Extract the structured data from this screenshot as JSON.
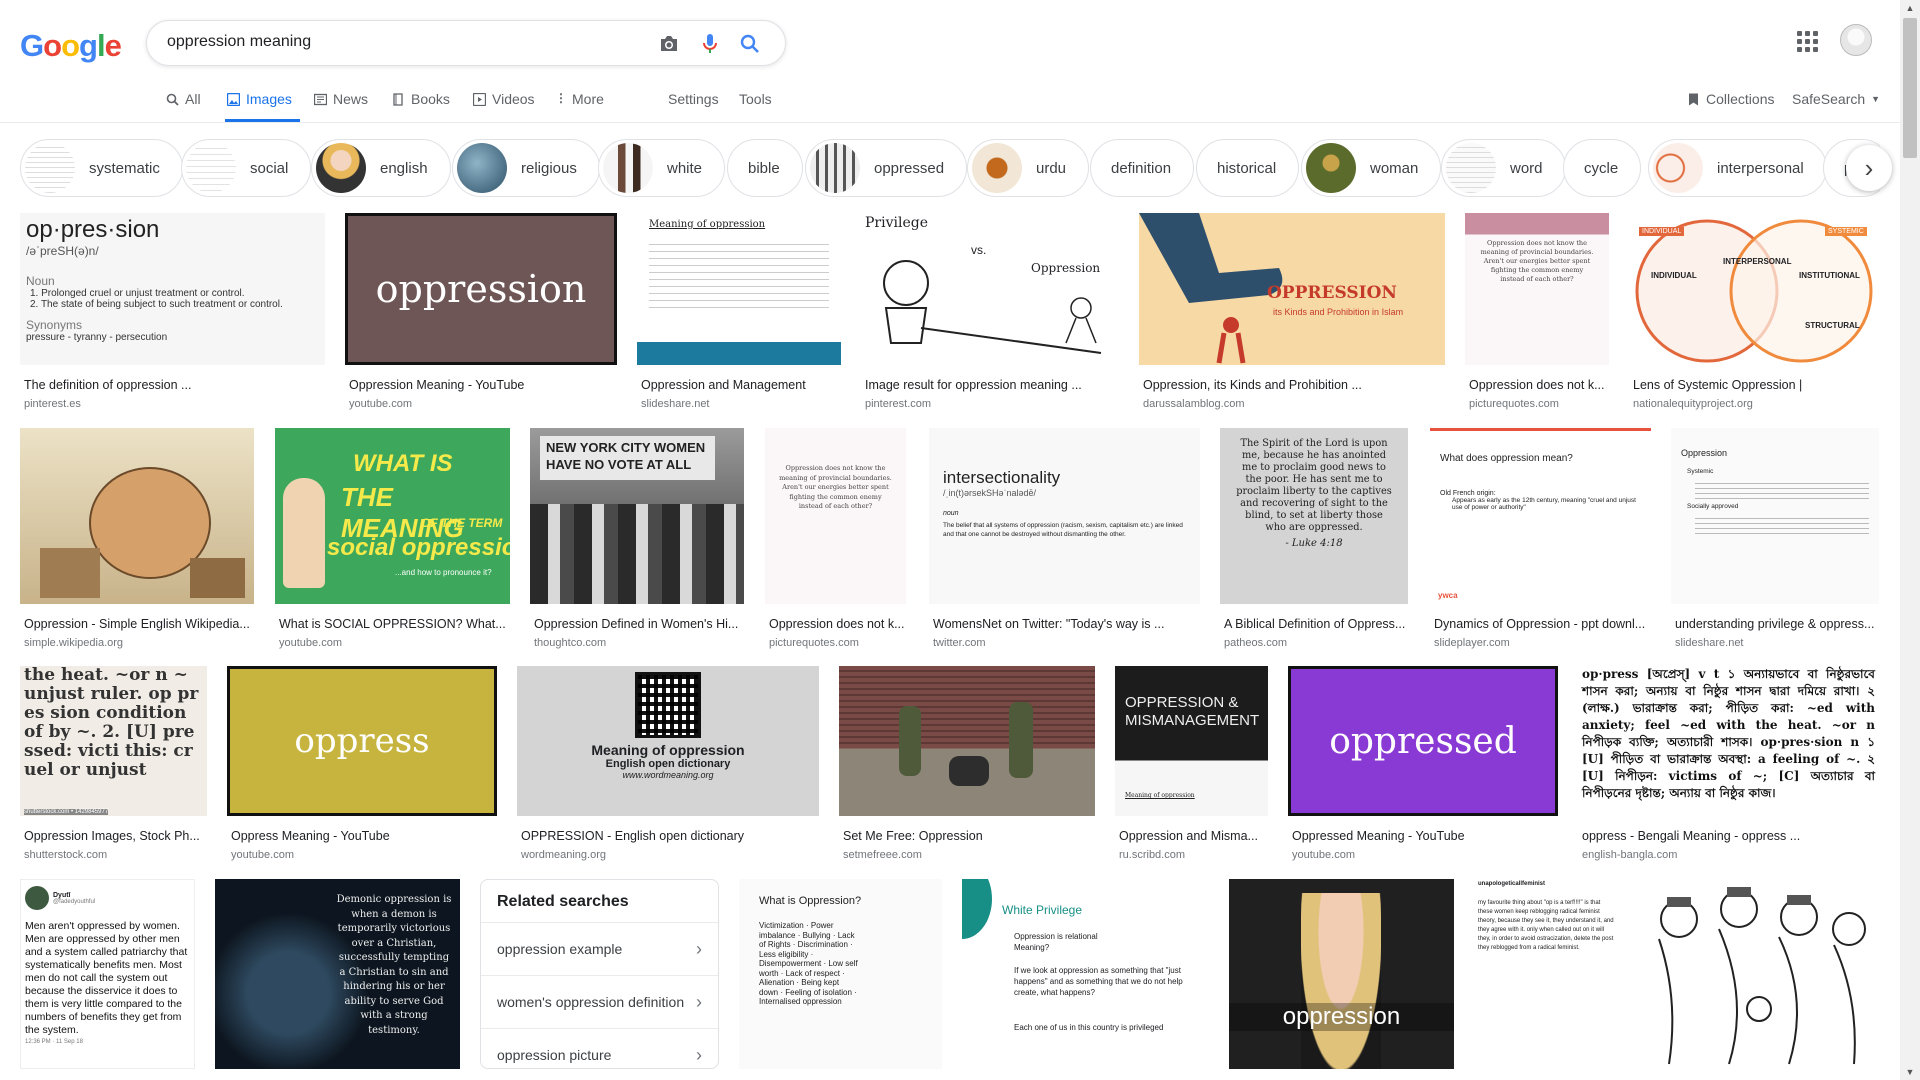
{
  "logo": {
    "letters": [
      "G",
      "o",
      "o",
      "g",
      "l",
      "e"
    ],
    "colors": [
      "#4285f4",
      "#ea4335",
      "#fbbc05",
      "#4285f4",
      "#34a853",
      "#ea4335"
    ]
  },
  "search": {
    "value": "oppression meaning"
  },
  "tabs": [
    {
      "label": "All",
      "icon": "search-icon"
    },
    {
      "label": "Images",
      "icon": "image-icon",
      "active": true
    },
    {
      "label": "News",
      "icon": "news-icon"
    },
    {
      "label": "Books",
      "icon": "book-icon"
    },
    {
      "label": "Videos",
      "icon": "video-icon"
    },
    {
      "label": "More",
      "icon": "more-vert-icon"
    },
    {
      "label": "Settings"
    },
    {
      "label": "Tools"
    }
  ],
  "right_tools": {
    "collections": "Collections",
    "safesearch": "SafeSearch"
  },
  "chips": [
    {
      "label": "systematic"
    },
    {
      "label": "social"
    },
    {
      "label": "english"
    },
    {
      "label": "religious"
    },
    {
      "label": "white"
    },
    {
      "label": "bible"
    },
    {
      "label": "oppressed"
    },
    {
      "label": "urdu"
    },
    {
      "label": "definition"
    },
    {
      "label": "historical"
    },
    {
      "label": "woman"
    },
    {
      "label": "word"
    },
    {
      "label": "cycle"
    },
    {
      "label": "interpersonal"
    },
    {
      "label": "pov"
    }
  ],
  "results": [
    {
      "title": "The definition of oppression ...",
      "site": "pinterest.es"
    },
    {
      "title": "Oppression Meaning - YouTube",
      "site": "youtube.com"
    },
    {
      "title": "Oppression and Management",
      "site": "slideshare.net"
    },
    {
      "title": "Image result for oppression meaning ...",
      "site": "pinterest.com"
    },
    {
      "title": "Oppression, its Kinds and Prohibition ...",
      "site": "darussalamblog.com"
    },
    {
      "title": "Oppression does not k...",
      "site": "picturequotes.com"
    },
    {
      "title": "Lens of Systemic Oppression |",
      "site": "nationalequityproject.org"
    },
    {
      "title": "Oppression - Simple English Wikipedia...",
      "site": "simple.wikipedia.org"
    },
    {
      "title": "What is SOCIAL OPPRESSION? What...",
      "site": "youtube.com"
    },
    {
      "title": "Oppression Defined in Women's Hi...",
      "site": "thoughtco.com"
    },
    {
      "title": "Oppression does not k...",
      "site": "picturequotes.com"
    },
    {
      "title": "WomensNet on Twitter: \"Today's way is ...",
      "site": "twitter.com"
    },
    {
      "title": "A Biblical Definition of Oppress...",
      "site": "patheos.com"
    },
    {
      "title": "Dynamics of Oppression - ppt downl...",
      "site": "slideplayer.com"
    },
    {
      "title": "understanding privilege & oppress...",
      "site": "slideshare.net"
    },
    {
      "title": "Oppression Images, Stock Ph...",
      "site": "shutterstock.com"
    },
    {
      "title": "Oppress Meaning - YouTube",
      "site": "youtube.com"
    },
    {
      "title": "OPPRESSION - English open dictionary",
      "site": "wordmeaning.org"
    },
    {
      "title": "Set Me Free: Oppression",
      "site": "setmefreee.com"
    },
    {
      "title": "Oppression and Misma...",
      "site": "ru.scribd.com"
    },
    {
      "title": "Oppressed Meaning - YouTube",
      "site": "youtube.com"
    },
    {
      "title": "oppress - Bengali Meaning - oppress ...",
      "site": "english-bangla.com"
    }
  ],
  "thumb_text": {
    "dict_word": "op·pres·sion",
    "dict_pron": "/əˈpreSH(ə)n/",
    "dict_pos": "Noun",
    "dict_def1": "1.  Prolonged cruel or unjust treatment or control.",
    "dict_def2": "2.  The state of being subject to such treatment or control.",
    "dict_syn_label": "Synonyms",
    "dict_syn": "pressure - tyranny - persecution",
    "yt_oppression": "oppression",
    "slide_title": "Meaning of oppression",
    "privilege_left": "Privilege",
    "privilege_vs": "vs.",
    "privilege_right": "Oppression",
    "islam_title": "OPPRESSION",
    "islam_sub": "its Kinds and Prohibition in Islam",
    "quote_text": "Oppression does not know the meaning of provincial boundaries. Aren't our energies better spent fighting the common enemy instead of each other?",
    "lens_individual": "INDIVIDUAL",
    "lens_interpersonal": "INTERPERSONAL",
    "lens_institutional": "INSTITUTIONAL",
    "lens_structural": "STRUCTURAL",
    "lens_systemic": "SYSTEMIC",
    "social_what": "WHAT IS",
    "social_meaning": "THE MEANING",
    "social_term": "OF THE TERM",
    "social_big": "social oppression",
    "social_pron": "...and how to pronounce it?",
    "sign_text": "NEW YORK CITY WOMEN HAVE NO VOTE AT ALL",
    "intersect_word": "intersectionality",
    "intersect_pron": "/ˌin(t)ərsekSHəˈnalədē/",
    "intersect_noun": "noun",
    "intersect_def": "The belief that all systems of oppression (racism, sexism, capitalism etc.) are linked and that one cannot be destroyed without dismantling the other.",
    "luke_text": "The Spirit of the Lord is upon me, because he has anointed me to proclaim good news to the poor. He has sent me to proclaim liberty to the captives and recovering of sight to the blind, to set at liberty those who are oppressed.",
    "luke_ref": "- Luke 4:18",
    "ywca_q": "What does oppression mean?",
    "ywca_b1": "Old French origin:",
    "ywca_b2": "Appears as early as the 12th century, meaning \"cruel and unjust use of power or authority\"",
    "ywca_logo": "ywca",
    "priv_title": "Oppression",
    "priv_b1": "Systemic",
    "priv_b2": "Socially approved",
    "shutter_text": "the heat. ~or n ~ unjust ruler. op pres sion condition of by ~. 2. [U] pressed: victi this: cruel or unjust",
    "shutter_credit": "shutterstock.com • 1429845977",
    "yt_oppress": "oppress",
    "wm_title": "Meaning of oppression",
    "wm_sub": "English open dictionary",
    "wm_url": "www.wordmeaning.org",
    "scribd_title": "OPPRESSION & MISMANAGEMENT",
    "scribd_sub": "Meaning of oppression",
    "yt_oppressed": "oppressed",
    "bengali_text": "op·press [অপ্রেস্] v t ১ অন্যায়ভাবে বা নিষ্ঠুরভাবে শাসন করা; অন্যায় বা নিষ্ঠুর শাসন দ্বারা দমিয়ে রাখা। ২ (লাক্ষ.) ভারাক্রান্ত করা; পীড়িত করা: ~ed with anxiety; feel ~ed with the heat. ~or n নিপীড়ক ব্যক্তি; অত্যাচারী শাসক। op·pres·sion n ১ [U] পীড়িত বা ভারাক্রান্ত অবস্থা: a feeling of ~. ২ [U] নিপীড়ন: victims of ~; [C] অত্যাচার বা নিপীড়নের দৃষ্টান্ত; অন্যায় বা নিষ্ঠুর কাজ।",
    "tweet_name": "Dyutī",
    "tweet_handle": "@fadedyouthful",
    "tweet_text": "Men aren't oppressed by women. Men are oppressed by other men and a system called patriarchy that systematically benefits men. Most men do not call the system out because the disservice it does to them is very little compared to the numbers of benefits they get from the system.",
    "tweet_time": "12:36 PM · 11 Sep 18",
    "demonic_text": "Demonic oppression is when a demon is temporarily victorious over a Christian, successfully tempting a Christian to sin and hindering his or her ability to serve God with a strong testimony.",
    "whatis_title": "What is Oppression?",
    "whatis_items": "Victimization · Power imbalance · Bullying · Lack of Rights · Discrimination · Less eligibility · Disempowerment · Low self worth · Lack of respect · Alienation · Being kept down · Feeling of isolation · Internalised oppression",
    "wp_title": "White Privilege",
    "wp_b1": "Oppression is relational Meaning?",
    "wp_b2": "If we look at oppression as something that \"just happens\" and as something that we do not help create, what happens?",
    "wp_b3": "Each one of us in this country is privileged",
    "speaker_caption": "oppression",
    "tumblr_handle": "unapologeticallfeminist",
    "tumblr_text": "my favourite thing about \"op is a terf!!!!\" is that these women keep reblogging radical feminist theory, because they see it, they understand it, and they agree with it. only when called out on it will they, in order to avoid ostracization, delete the post they reblogged from a radical feminist."
  },
  "related": {
    "heading": "Related searches",
    "items": [
      "oppression example",
      "women's oppression definition",
      "oppression picture"
    ]
  },
  "colors": {
    "accent": "#1a73e8",
    "link_gray": "#70757a"
  }
}
